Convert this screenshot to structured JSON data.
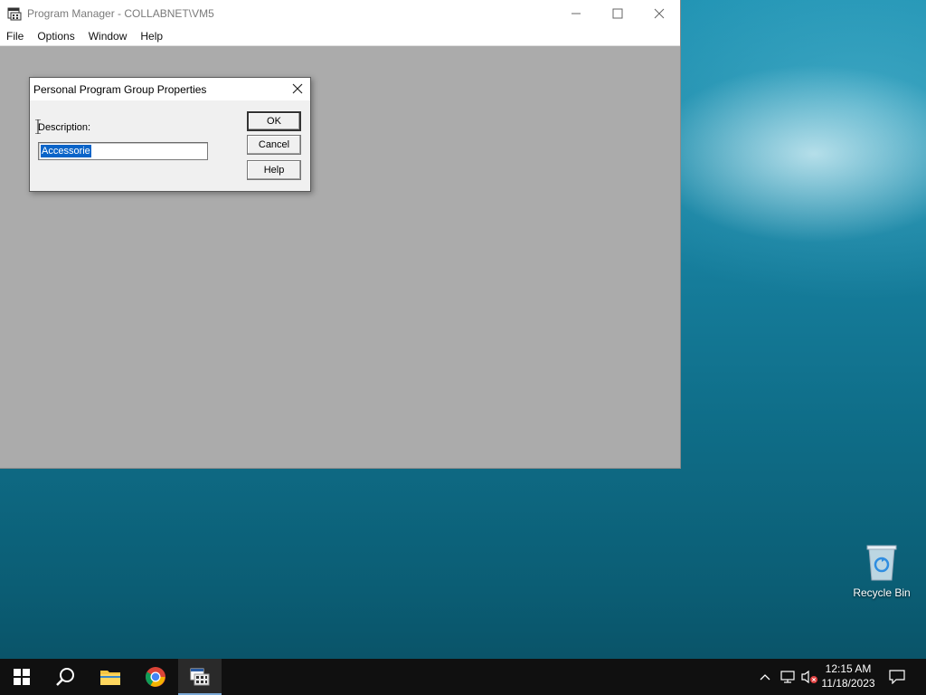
{
  "window": {
    "title": "Program Manager - COLLABNET\\VM5",
    "menu": [
      "File",
      "Options",
      "Window",
      "Help"
    ],
    "controls": [
      "minimize-icon",
      "maximize-icon",
      "close-icon"
    ]
  },
  "dialog": {
    "title": "Personal Program Group Properties",
    "description_label": "Description:",
    "description_value": "Accessorie",
    "buttons": {
      "ok": "OK",
      "cancel": "Cancel",
      "help": "Help"
    }
  },
  "desktop": {
    "recycle_bin_label": "Recycle Bin"
  },
  "taskbar": {
    "apps": [
      "windows-start-icon",
      "search-icon",
      "file-explorer-icon",
      "chrome-icon",
      "program-manager-icon"
    ],
    "tray": [
      "chevron-up-icon",
      "network-icon",
      "volume-muted-icon",
      "notification-icon"
    ],
    "time": "12:15 AM",
    "date": "11/18/2023"
  },
  "colors": {
    "selection": "#0a64c8",
    "mdi_background": "#ababab",
    "taskbar": "#101010",
    "taskbar_accent": "#7aa8d6"
  }
}
